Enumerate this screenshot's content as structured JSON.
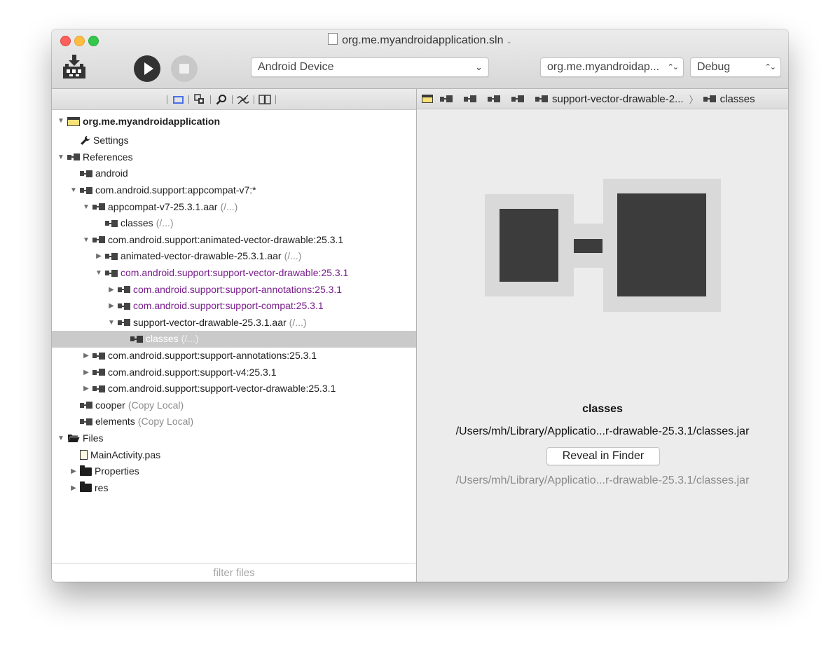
{
  "window": {
    "title": "org.me.myandroidapplication.sln",
    "title_chevron": "⌄"
  },
  "toolbar": {
    "device_select": "Android Device",
    "config_select": "org.me.myandroidap...",
    "build_select": "Debug",
    "select_arrow_down": "⌄",
    "select_arrow_updown": "⌃⌄"
  },
  "solution_tree": {
    "items": [
      {
        "label": "org.me.myandroidapplication",
        "suffix": "",
        "depth": 0,
        "disclosure": "open",
        "icon": "project-icon",
        "tone": "normal",
        "root": true
      },
      {
        "label": "Settings",
        "suffix": "",
        "depth": 1,
        "disclosure": "none",
        "icon": "wrench-icon",
        "tone": "normal"
      },
      {
        "label": "References",
        "suffix": "",
        "depth": 0,
        "disclosure": "open",
        "icon": "reference-icon",
        "tone": "normal"
      },
      {
        "label": "android",
        "suffix": "",
        "depth": 1,
        "disclosure": "none",
        "icon": "reference-icon",
        "tone": "normal"
      },
      {
        "label": "com.android.support:appcompat-v7:*",
        "suffix": "",
        "depth": 1,
        "disclosure": "open",
        "icon": "reference-icon",
        "tone": "normal"
      },
      {
        "label": "appcompat-v7-25.3.1.aar",
        "suffix": "(/...)",
        "depth": 2,
        "disclosure": "open",
        "icon": "reference-icon",
        "tone": "normal"
      },
      {
        "label": "classes",
        "suffix": "(/...)",
        "depth": 3,
        "disclosure": "none",
        "icon": "reference-icon",
        "tone": "normal"
      },
      {
        "label": "com.android.support:animated-vector-drawable:25.3.1",
        "suffix": "",
        "depth": 2,
        "disclosure": "open",
        "icon": "reference-icon",
        "tone": "normal"
      },
      {
        "label": "animated-vector-drawable-25.3.1.aar",
        "suffix": "(/...)",
        "depth": 3,
        "disclosure": "closed",
        "icon": "reference-icon",
        "tone": "normal"
      },
      {
        "label": "com.android.support:support-vector-drawable:25.3.1",
        "suffix": "",
        "depth": 3,
        "disclosure": "open",
        "icon": "reference-icon",
        "tone": "purple"
      },
      {
        "label": "com.android.support:support-annotations:25.3.1",
        "suffix": "",
        "depth": 4,
        "disclosure": "closed",
        "icon": "reference-icon",
        "tone": "purple"
      },
      {
        "label": "com.android.support:support-compat:25.3.1",
        "suffix": "",
        "depth": 4,
        "disclosure": "closed",
        "icon": "reference-icon",
        "tone": "purple"
      },
      {
        "label": "support-vector-drawable-25.3.1.aar",
        "suffix": "(/...)",
        "depth": 4,
        "disclosure": "open",
        "icon": "reference-icon",
        "tone": "normal"
      },
      {
        "label": "classes",
        "suffix": "(/...)",
        "depth": 5,
        "disclosure": "none",
        "icon": "reference-icon",
        "tone": "normal",
        "selected": true
      },
      {
        "label": "com.android.support:support-annotations:25.3.1",
        "suffix": "",
        "depth": 2,
        "disclosure": "closed",
        "icon": "reference-icon",
        "tone": "normal"
      },
      {
        "label": "com.android.support:support-v4:25.3.1",
        "suffix": "",
        "depth": 2,
        "disclosure": "closed",
        "icon": "reference-icon",
        "tone": "normal"
      },
      {
        "label": "com.android.support:support-vector-drawable:25.3.1",
        "suffix": "",
        "depth": 2,
        "disclosure": "closed",
        "icon": "reference-icon",
        "tone": "normal"
      },
      {
        "label": "cooper",
        "suffix": "(Copy Local)",
        "depth": 1,
        "disclosure": "none",
        "icon": "reference-icon",
        "tone": "normal"
      },
      {
        "label": "elements",
        "suffix": "(Copy Local)",
        "depth": 1,
        "disclosure": "none",
        "icon": "reference-icon",
        "tone": "normal"
      },
      {
        "label": "Files",
        "suffix": "",
        "depth": 0,
        "disclosure": "open",
        "icon": "open-folder-icon",
        "tone": "normal"
      },
      {
        "label": "MainActivity.pas",
        "suffix": "",
        "depth": 1,
        "disclosure": "none",
        "icon": "file-icon",
        "tone": "normal"
      },
      {
        "label": "Properties",
        "suffix": "",
        "depth": 1,
        "disclosure": "closed",
        "icon": "folder-icon",
        "tone": "normal"
      },
      {
        "label": "res",
        "suffix": "",
        "depth": 1,
        "disclosure": "closed",
        "icon": "folder-icon",
        "tone": "normal"
      }
    ],
    "filter_placeholder": "filter files"
  },
  "breadcrumb": {
    "items": [
      {
        "label": ""
      },
      {
        "label": ""
      },
      {
        "label": ""
      },
      {
        "label": ""
      },
      {
        "label": ""
      },
      {
        "label": "support-vector-drawable-2..."
      },
      {
        "label": "classes"
      }
    ],
    "separator": "〉"
  },
  "detail": {
    "title": "classes",
    "path": "/Users/mh/Library/Applicatio...r-drawable-25.3.1/classes.jar",
    "reveal_label": "Reveal in Finder",
    "path_secondary": "/Users/mh/Library/Applicatio...r-drawable-25.3.1/classes.jar"
  },
  "colors": {
    "accent": "#4a70e6",
    "purple_text": "#7a1e8c",
    "gray_text": "#8c8c8c",
    "selection": "#cacaca"
  }
}
